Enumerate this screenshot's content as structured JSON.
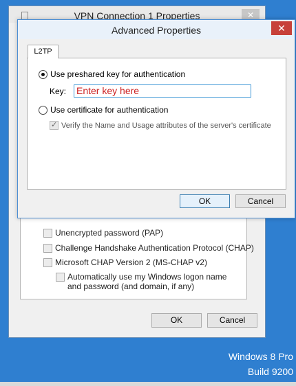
{
  "background_window": {
    "title": "VPN Connection 1 Properties",
    "close_glyph": "✕",
    "options": [
      {
        "label": "Unencrypted password (PAP)"
      },
      {
        "label": "Challenge Handshake Authentication Protocol (CHAP)"
      },
      {
        "label": "Microsoft CHAP Version 2 (MS-CHAP v2)"
      }
    ],
    "sub_option": "Automatically use my Windows logon name and password (and domain, if any)",
    "ok_label": "OK",
    "cancel_label": "Cancel"
  },
  "dialog": {
    "title": "Advanced Properties",
    "close_glyph": "✕",
    "tab_label": "L2TP",
    "radio_psk_label": "Use preshared key for authentication",
    "key_label": "Key:",
    "key_value": "Enter key here",
    "radio_cert_label": "Use certificate for authentication",
    "verify_label": "Verify the Name and Usage attributes of the server's certificate",
    "ok_label": "OK",
    "cancel_label": "Cancel"
  },
  "watermark": {
    "line1": "Windows 8 Pro",
    "line2": "Build 9200"
  },
  "colors": {
    "desktop": "#2f7fd0",
    "close_red": "#c7413a",
    "key_text": "#cc2222",
    "input_border": "#3c96d6"
  }
}
